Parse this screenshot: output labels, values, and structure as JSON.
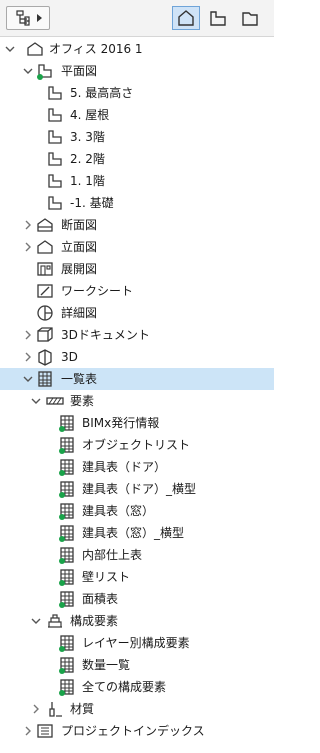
{
  "toolbar": {
    "left_icon": "hierarchy-icon",
    "views": [
      "project-map-icon",
      "view-map-icon",
      "layout-book-icon"
    ]
  },
  "tree": [
    {
      "label": "オフィス 2016 1",
      "level": 0,
      "disc": "open",
      "icon": "house-icon"
    },
    {
      "label": "平面図",
      "level": 1,
      "disc": "open",
      "icon": "floor-plan-icon",
      "dot": true
    },
    {
      "label": "5. 最高高さ",
      "level": 2,
      "disc": "none",
      "icon": "story-icon"
    },
    {
      "label": "4. 屋根",
      "level": 2,
      "disc": "none",
      "icon": "story-icon"
    },
    {
      "label": "3. 3階",
      "level": 2,
      "disc": "none",
      "icon": "story-icon"
    },
    {
      "label": "2. 2階",
      "level": 2,
      "disc": "none",
      "icon": "story-icon"
    },
    {
      "label": "1. 1階",
      "level": 2,
      "disc": "none",
      "icon": "story-icon"
    },
    {
      "label": "-1. 基礎",
      "level": 2,
      "disc": "none",
      "icon": "story-icon"
    },
    {
      "label": "断面図",
      "level": 1,
      "disc": "closed",
      "icon": "section-icon"
    },
    {
      "label": "立面図",
      "level": 1,
      "disc": "closed",
      "icon": "elevation-icon"
    },
    {
      "label": "展開図",
      "level": 1,
      "disc": "none",
      "icon": "interior-elevation-icon"
    },
    {
      "label": "ワークシート",
      "level": 1,
      "disc": "none",
      "icon": "worksheet-icon"
    },
    {
      "label": "詳細図",
      "level": 1,
      "disc": "none",
      "icon": "detail-icon"
    },
    {
      "label": "3Dドキュメント",
      "level": 1,
      "disc": "closed",
      "icon": "3d-document-icon"
    },
    {
      "label": "3D",
      "level": 1,
      "disc": "closed",
      "icon": "3d-icon"
    },
    {
      "label": "一覧表",
      "level": 1,
      "disc": "open",
      "icon": "schedule-icon",
      "selected": true
    },
    {
      "label": "要素",
      "level": 2,
      "disc": "open",
      "icon": "elements-icon"
    },
    {
      "label": "BIMx発行情報",
      "level": 3,
      "disc": "none",
      "icon": "schedule-icon",
      "dot": true
    },
    {
      "label": "オブジェクトリスト",
      "level": 3,
      "disc": "none",
      "icon": "schedule-icon",
      "dot": true
    },
    {
      "label": "建具表（ドア）",
      "level": 3,
      "disc": "none",
      "icon": "schedule-icon",
      "dot": true
    },
    {
      "label": "建具表（ドア）_横型",
      "level": 3,
      "disc": "none",
      "icon": "schedule-icon",
      "dot": true
    },
    {
      "label": "建具表（窓）",
      "level": 3,
      "disc": "none",
      "icon": "schedule-icon",
      "dot": true
    },
    {
      "label": "建具表（窓）_横型",
      "level": 3,
      "disc": "none",
      "icon": "schedule-icon",
      "dot": true
    },
    {
      "label": "内部仕上表",
      "level": 3,
      "disc": "none",
      "icon": "schedule-icon",
      "dot": true
    },
    {
      "label": "壁リスト",
      "level": 3,
      "disc": "none",
      "icon": "schedule-icon",
      "dot": true
    },
    {
      "label": "面積表",
      "level": 3,
      "disc": "none",
      "icon": "schedule-icon",
      "dot": true
    },
    {
      "label": "構成要素",
      "level": 2,
      "disc": "open",
      "icon": "components-icon"
    },
    {
      "label": "レイヤー別構成要素",
      "level": 3,
      "disc": "none",
      "icon": "schedule-icon",
      "dot": true
    },
    {
      "label": "数量一覧",
      "level": 3,
      "disc": "none",
      "icon": "schedule-icon",
      "dot": true
    },
    {
      "label": "全ての構成要素",
      "level": 3,
      "disc": "none",
      "icon": "schedule-icon",
      "dot": true
    },
    {
      "label": "材質",
      "level": 2,
      "disc": "closed",
      "icon": "surfaces-icon"
    },
    {
      "label": "プロジェクトインデックス",
      "level": 1,
      "disc": "closed",
      "icon": "project-index-icon"
    }
  ],
  "colors": {
    "dot": "#1aa34a",
    "selected": "#cce4f7",
    "icon": "#3a3a3a"
  }
}
